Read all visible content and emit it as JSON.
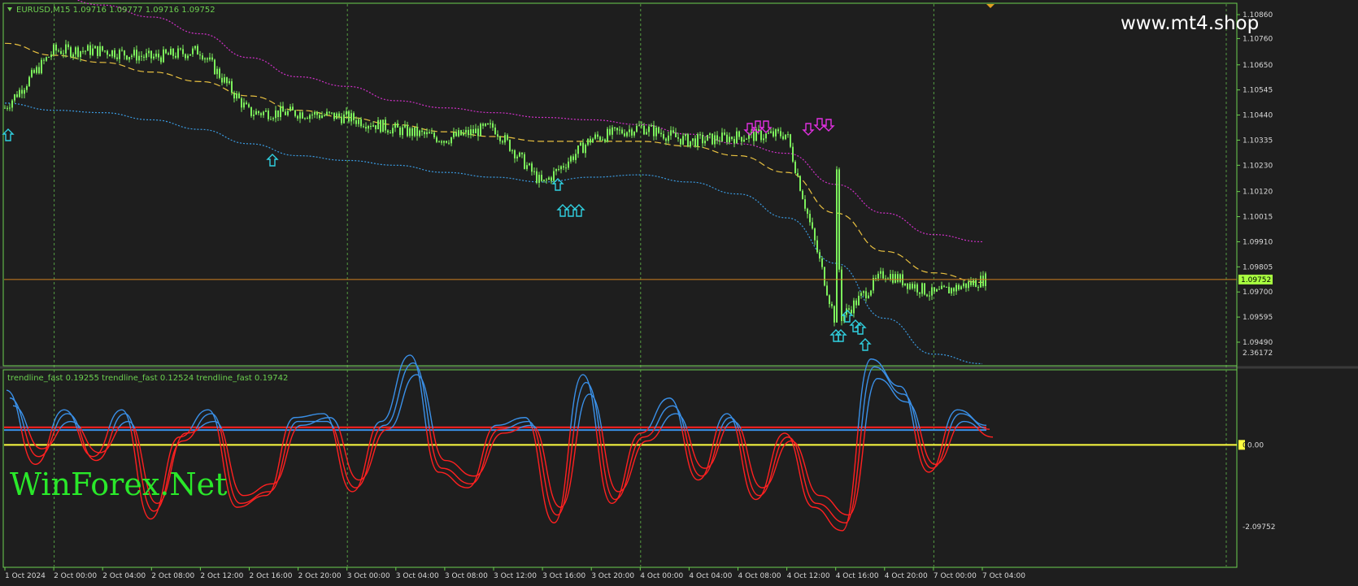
{
  "chart_data": [
    {
      "type": "candlestick",
      "title": "EURUSD,M15  1.09716 1.09777 1.09716 1.09752",
      "watermark": "www.mt4.shop",
      "current_price": 1.09752,
      "price_axis_labels": [
        "1.10860",
        "1.10760",
        "1.10650",
        "1.10545",
        "1.10440",
        "1.10335",
        "1.10230",
        "1.10120",
        "1.10015",
        "1.09910",
        "1.09805",
        "1.09700",
        "1.09595",
        "1.09490"
      ],
      "ylim": [
        1.0949,
        1.1086
      ],
      "x_labels": [
        "1 Oct 2024",
        "2 Oct 00:00",
        "2 Oct 04:00",
        "2 Oct 08:00",
        "2 Oct 12:00",
        "2 Oct 16:00",
        "2 Oct 20:00",
        "3 Oct 00:00",
        "3 Oct 04:00",
        "3 Oct 08:00",
        "3 Oct 12:00",
        "3 Oct 16:00",
        "3 Oct 20:00",
        "4 Oct 00:00",
        "4 Oct 04:00",
        "4 Oct 08:00",
        "4 Oct 12:00",
        "4 Oct 16:00",
        "4 Oct 20:00",
        "7 Oct 00:00",
        "7 Oct 04:00"
      ],
      "close_by_label": [
        1.1047,
        1.1071,
        1.1071,
        1.1068,
        1.1071,
        1.1045,
        1.1045,
        1.1043,
        1.1038,
        1.1034,
        1.1039,
        1.1015,
        1.1034,
        1.1039,
        1.1033,
        1.1035,
        1.1036,
        1.0957,
        1.0978,
        1.0969,
        1.0975
      ],
      "series": [
        {
          "name": "ma_upper",
          "style": "dotted",
          "color": "#d030c8",
          "values": [
            1.1098,
            1.1094,
            1.109,
            1.1085,
            1.1078,
            1.1068,
            1.106,
            1.1056,
            1.105,
            1.1047,
            1.1045,
            1.1043,
            1.1042,
            1.104,
            1.1036,
            1.1032,
            1.1028,
            1.1015,
            1.1003,
            1.0994,
            1.0991
          ]
        },
        {
          "name": "ma_middle",
          "style": "dashed",
          "color": "#e8c040",
          "values": [
            1.1074,
            1.1069,
            1.1066,
            1.1062,
            1.1058,
            1.1052,
            1.1046,
            1.1043,
            1.104,
            1.1037,
            1.1035,
            1.1033,
            1.1033,
            1.1033,
            1.1031,
            1.1027,
            1.102,
            1.1003,
            1.0987,
            1.0978,
            1.0974
          ]
        },
        {
          "name": "ma_lower",
          "style": "dotted",
          "color": "#3a9ae0",
          "values": [
            1.1049,
            1.1046,
            1.1045,
            1.1042,
            1.1038,
            1.1032,
            1.1027,
            1.1025,
            1.1023,
            1.102,
            1.1018,
            1.1016,
            1.1018,
            1.1019,
            1.1016,
            1.1011,
            1.1001,
            1.0982,
            1.0959,
            1.0944,
            1.094
          ]
        }
      ],
      "arrows_up": [
        "1 Oct 2024",
        "2 Oct 16:00",
        "3 Oct 16:00",
        "3 Oct 16:00",
        "3 Oct 16:00",
        "4 Oct 16:00",
        "4 Oct 16:00",
        "4 Oct 16:00",
        "4 Oct 20:00"
      ],
      "arrows_down": [
        "4 Oct 08:00",
        "4 Oct 08:00",
        "4 Oct 08:00",
        "4 Oct 12:00",
        "4 Oct 12:00",
        "4 Oct 12:00"
      ]
    },
    {
      "type": "line",
      "title": "trendline_fast 0.19255  trendline_fast 0.12524  trendline_fast 0.19742",
      "watermark": "WinForex.Net",
      "axis_labels": [
        "2.36172",
        "0.00",
        "-2.09752"
      ],
      "ylim": [
        -2.09752,
        2.36172
      ],
      "levels": [
        {
          "value": 0.0,
          "color": "#ffff40"
        },
        {
          "value": 0.38,
          "color": "#3a90e8"
        },
        {
          "value": 0.45,
          "color": "#ff2020"
        }
      ],
      "series": [
        {
          "name": "trendline_fast",
          "values": [
            1.4,
            -0.5,
            0.9,
            -0.3,
            0.9,
            -1.9,
            0.2,
            0.9,
            -1.6,
            -1.3,
            0.7,
            0.8,
            -1.2,
            0.6,
            2.3,
            -0.7,
            -1.1,
            0.5,
            0.7,
            -2.0,
            1.8,
            -1.5,
            0.3,
            1.2,
            -0.9,
            0.8,
            -1.4,
            0.3,
            -1.6,
            -2.2,
            2.2,
            1.5,
            -0.7,
            0.9,
            0.5
          ]
        },
        {
          "name": "trendline_fast",
          "values": [
            1.2,
            -0.3,
            0.8,
            -0.4,
            0.8,
            -1.7,
            0.1,
            0.8,
            -1.5,
            -1.2,
            0.6,
            0.6,
            -1.1,
            0.5,
            2.1,
            -0.6,
            -1.0,
            0.4,
            0.6,
            -1.8,
            1.6,
            -1.4,
            0.2,
            1.0,
            -0.8,
            0.7,
            -1.3,
            0.2,
            -1.5,
            -2.0,
            2.0,
            1.3,
            -0.6,
            0.8,
            0.4
          ]
        },
        {
          "name": "trendline_fast",
          "values": [
            1.0,
            -0.1,
            0.6,
            -0.2,
            0.6,
            -1.5,
            0.3,
            0.6,
            -1.3,
            -1.0,
            0.5,
            0.7,
            -0.9,
            0.4,
            1.8,
            -0.4,
            -0.8,
            0.3,
            0.5,
            -1.6,
            1.3,
            -1.2,
            0.1,
            0.8,
            -0.6,
            0.6,
            -1.1,
            0.1,
            -1.3,
            -1.8,
            1.7,
            1.1,
            -0.5,
            0.6,
            0.2
          ]
        }
      ]
    }
  ]
}
